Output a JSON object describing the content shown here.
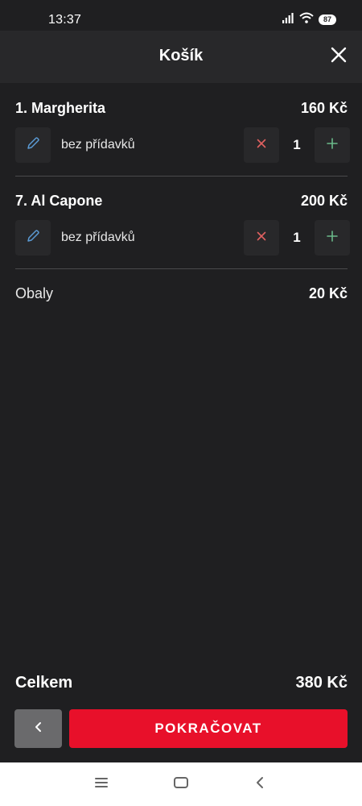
{
  "status_bar": {
    "time": "13:37",
    "battery": "87"
  },
  "header": {
    "title": "Košík"
  },
  "cart": {
    "items": [
      {
        "name": "1. Margherita",
        "price": "160 Kč",
        "addons": "bez přídavků",
        "quantity": "1"
      },
      {
        "name": "7. Al Capone",
        "price": "200 Kč",
        "addons": "bez přídavků",
        "quantity": "1"
      }
    ],
    "packaging": {
      "label": "Obaly",
      "price": "20 Kč"
    }
  },
  "total": {
    "label": "Celkem",
    "value": "380 Kč"
  },
  "footer": {
    "continue_label": "POKRAČOVAT"
  },
  "colors": {
    "background": "#1f1f21",
    "panel": "#28282a",
    "accent": "#e8102a",
    "edit": "#5b9bd5",
    "minus": "#e06060",
    "plus": "#6ab98a"
  },
  "icons": [
    "signal-icon",
    "wifi-icon",
    "battery-icon",
    "close-icon",
    "pencil-icon",
    "remove-icon",
    "plus-icon",
    "chevron-left-icon",
    "menu-icon",
    "home-icon",
    "back-icon"
  ]
}
